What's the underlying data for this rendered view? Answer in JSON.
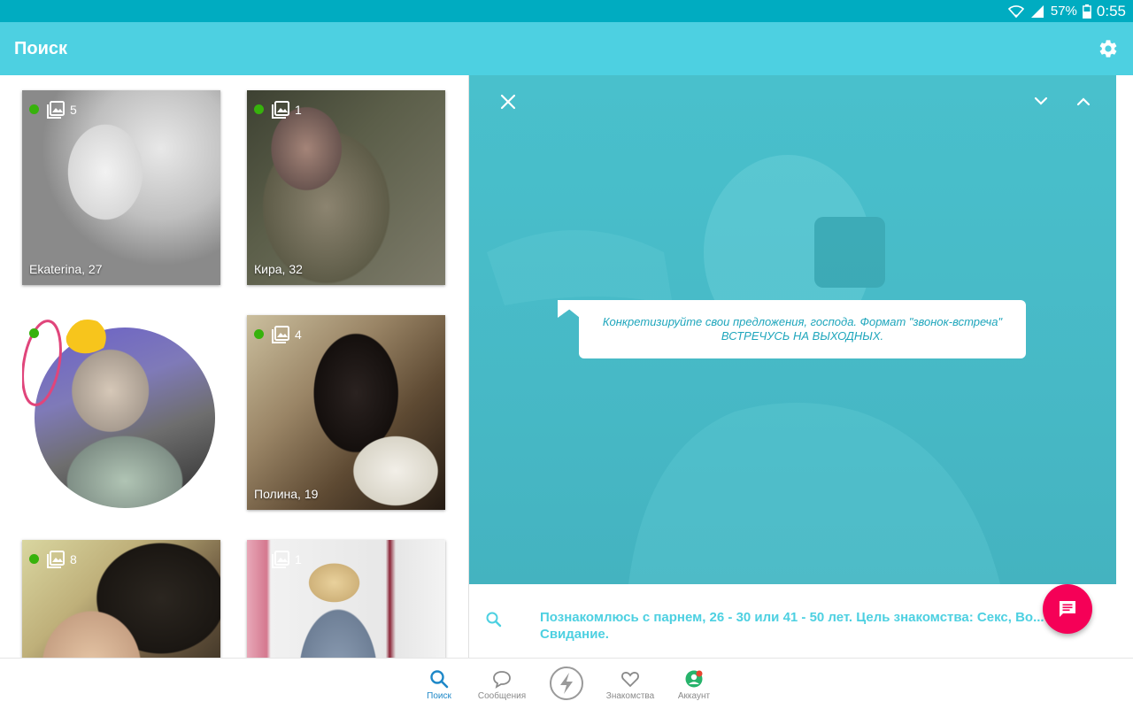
{
  "status_bar": {
    "battery": "57%",
    "time": "0:55"
  },
  "app_bar": {
    "title": "Поиск",
    "settings_icon": "gear-icon"
  },
  "grid": {
    "cards": [
      {
        "name": "Ekaterina, 27",
        "photo_count": "5",
        "online": true
      },
      {
        "name": "Кира, 32",
        "photo_count": "1",
        "online": true
      },
      {
        "name": "",
        "photo_count": "",
        "online": true
      },
      {
        "name": "Полина, 19",
        "photo_count": "4",
        "online": true
      },
      {
        "name": "",
        "photo_count": "8",
        "online": true
      },
      {
        "name": "",
        "photo_count": "1",
        "online": false
      }
    ]
  },
  "profile": {
    "status_line1": "Конкретизируйте свои предложения, господа. Формат \"звонок-встреча\"",
    "status_line2": "ВСТРЕЧУСЬ НА ВЫХОДНЫХ.",
    "intent_text": "Познакомлюсь с парнем, 26 - 30 или 41 - 50 лет. Цель знакомства: Секс, Во... Свидание."
  },
  "bottom_nav": {
    "items": [
      {
        "label": "Поиск",
        "icon": "search-icon",
        "active": true
      },
      {
        "label": "Сообщения",
        "icon": "chat-bubble-icon",
        "active": false
      },
      {
        "label": "",
        "icon": "lightning-icon",
        "active": false
      },
      {
        "label": "Знакомства",
        "icon": "heart-icon",
        "active": false
      },
      {
        "label": "Аккаунт",
        "icon": "account-icon",
        "active": false
      }
    ]
  },
  "colors": {
    "status_bar": "#00acc1",
    "app_bar": "#4dd0e1",
    "accent": "#f50057",
    "online": "#37b20c",
    "nav_active": "#1e88c8"
  }
}
